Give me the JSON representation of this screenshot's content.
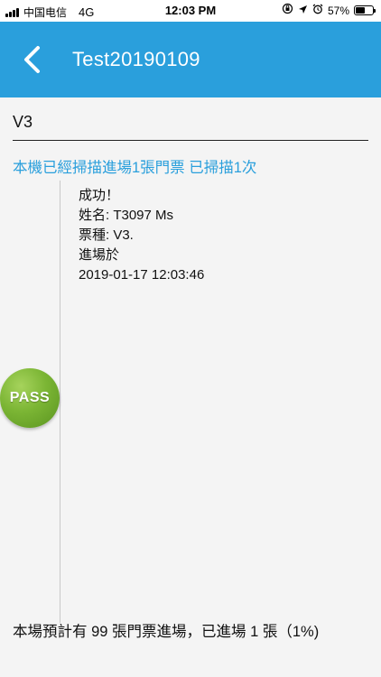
{
  "status_bar": {
    "carrier": "中国电信",
    "network": "4G",
    "time": "12:03 PM",
    "battery_percent": "57%",
    "battery_level": 0.57
  },
  "header": {
    "title": "Test20190109",
    "background_color": "#2a9fdc"
  },
  "event_field": {
    "value": "V3"
  },
  "scan_summary": "本機已經掃描進場1張門票 已掃描1次",
  "scan_result": {
    "status": "成功！",
    "name_line": "姓名: T3097 Ms",
    "ticket_type_line": "票種: V3.",
    "entry_label": "進場於",
    "entry_time": "2019-01-17 12:03:46"
  },
  "badge": {
    "label": "PASS",
    "color": "#7bb534"
  },
  "footer": {
    "text": "本場預計有 99 張門票進場，已進場 1 張（1%)"
  },
  "icons": {
    "back": "chevron-left-icon",
    "location": "location-arrow-icon",
    "alarm": "alarm-clock-icon",
    "orientation_lock": "orientation-lock-icon"
  }
}
